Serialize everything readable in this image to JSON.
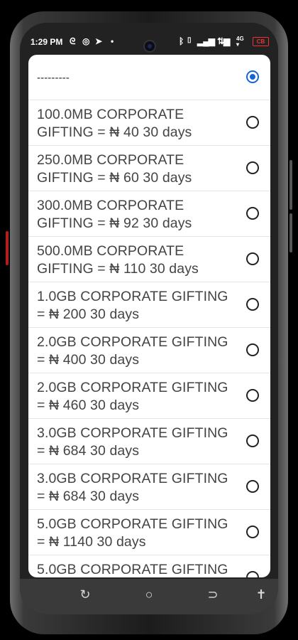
{
  "status_bar": {
    "time": "1:29 PM",
    "left_icons": [
      "gesture-icon",
      "whatsapp-icon",
      "telegram-icon",
      "dot-icon"
    ],
    "right_icons": [
      "bluetooth-icon",
      "vibrate-icon",
      "signal-icon",
      "wifi-icon",
      "data-icon"
    ],
    "battery": "CB"
  },
  "dialog": {
    "options": [
      {
        "label": "---------",
        "selected": true
      },
      {
        "label": "100.0MB CORPORATE GIFTING = ₦ 40 30 days",
        "selected": false
      },
      {
        "label": "250.0MB CORPORATE GIFTING = ₦ 60 30 days",
        "selected": false
      },
      {
        "label": "300.0MB CORPORATE GIFTING = ₦ 92 30 days",
        "selected": false
      },
      {
        "label": "500.0MB CORPORATE GIFTING = ₦ 110 30 days",
        "selected": false
      },
      {
        "label": "1.0GB CORPORATE GIFTING = ₦ 200 30 days",
        "selected": false
      },
      {
        "label": "2.0GB CORPORATE GIFTING = ₦ 400 30 days",
        "selected": false
      },
      {
        "label": "2.0GB CORPORATE GIFTING = ₦ 460 30 days",
        "selected": false
      },
      {
        "label": "3.0GB CORPORATE GIFTING = ₦ 684 30 days",
        "selected": false
      },
      {
        "label": "3.0GB CORPORATE GIFTING = ₦ 684 30 days",
        "selected": false
      },
      {
        "label": "5.0GB CORPORATE GIFTING = ₦ 1140 30 days",
        "selected": false
      },
      {
        "label": "5.0GB CORPORATE GIFTING",
        "selected": false
      }
    ]
  },
  "nav_bar": {
    "buttons": [
      "recents-icon",
      "home-icon",
      "back-icon",
      "accessibility-icon"
    ]
  },
  "colors": {
    "accent": "#1565d8",
    "battery_warning": "#e33333"
  }
}
